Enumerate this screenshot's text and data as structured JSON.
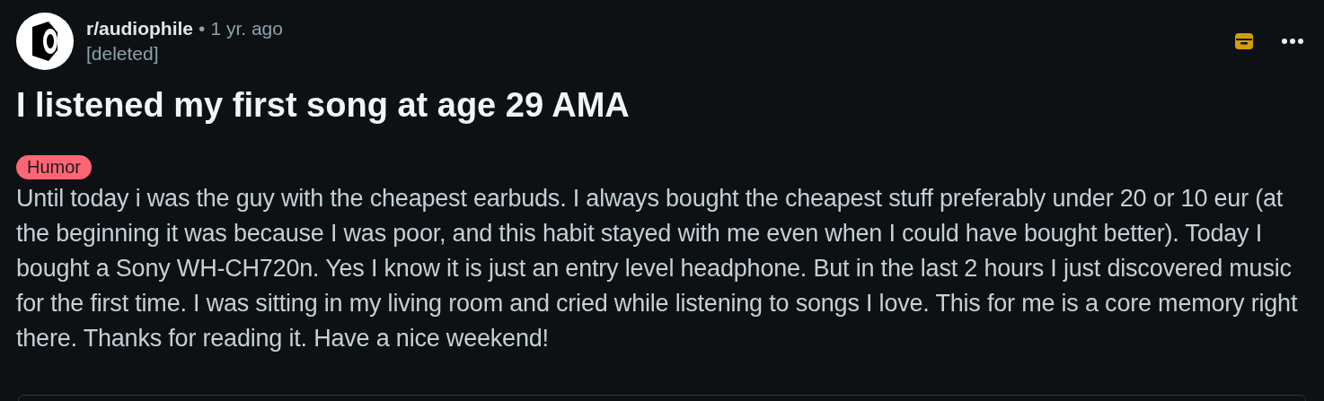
{
  "post": {
    "subreddit": "r/audiophile",
    "separator": "•",
    "time": "1 yr. ago",
    "author": "[deleted]",
    "title": "I listened my first song at age 29 AMA",
    "flair": {
      "label": "Humor",
      "color": "#ff6675"
    },
    "body": "Until today i was the guy with the cheapest earbuds. I always bought the cheapest stuff preferably under 20 or 10 eur (at the beginning it was because I was poor, and this habit stayed with me even when I could have bought better). Today I bought a Sony WH-CH720n. Yes I know it is just an entry level headphone. But in the last 2 hours I just discovered music for the first time. I was sitting in my living room and cried while listening to songs I love. This for me is a core memory right there. Thanks for reading it. Have a nice weekend!",
    "archived": true
  }
}
